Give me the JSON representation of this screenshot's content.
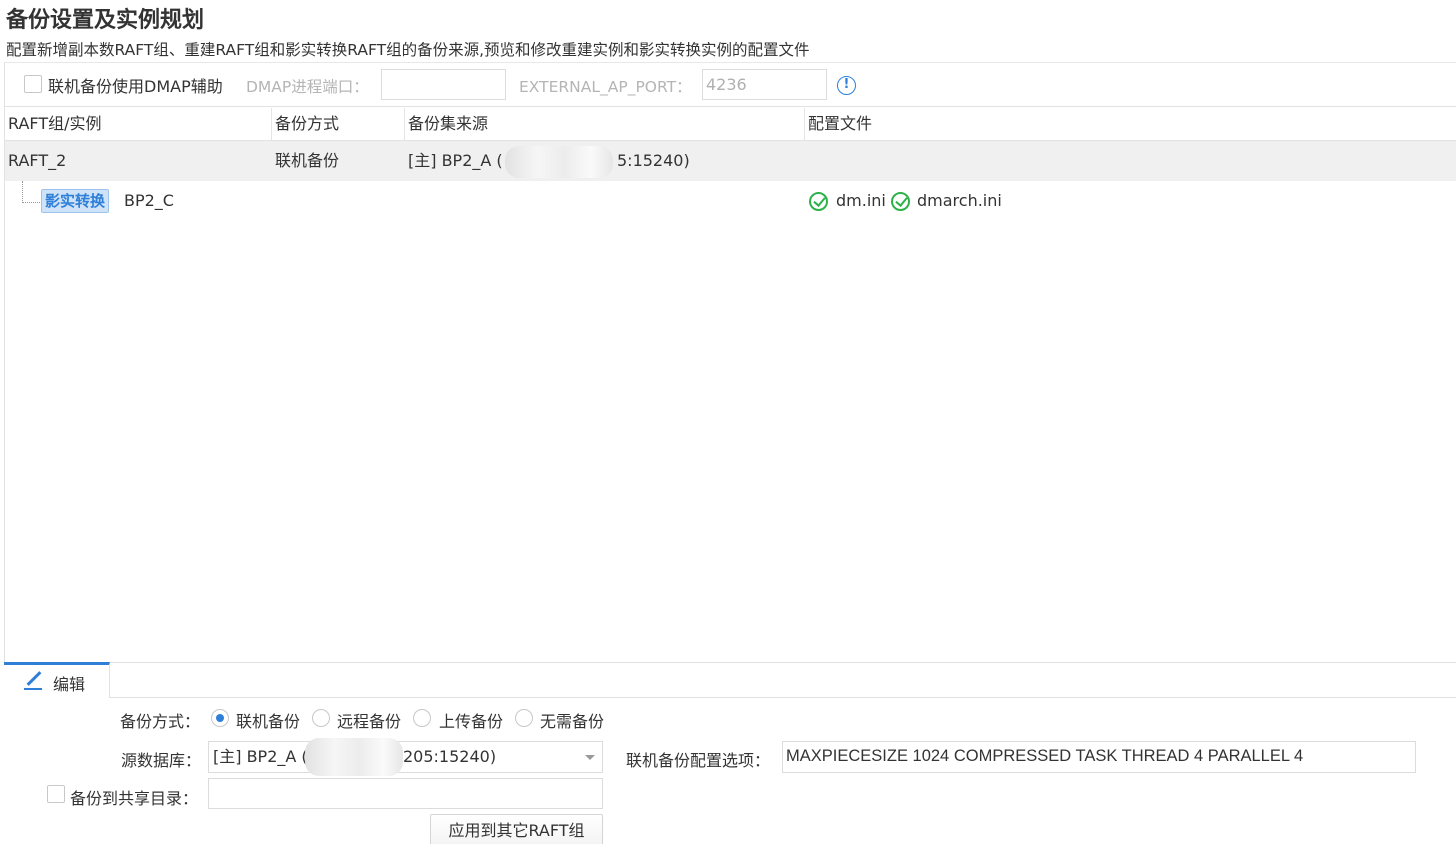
{
  "header": {
    "title": "备份设置及实例规划",
    "description": "配置新增副本数RAFT组、重建RAFT组和影实转换RAFT组的备份来源,预览和修改重建实例和影实转换实例的配置文件"
  },
  "dmap": {
    "checkbox_label": "联机备份使用DMAP辅助",
    "checked": false,
    "port_label": "DMAP进程端口：",
    "port_value": "",
    "ext_port_label": "EXTERNAL_AP_PORT：",
    "ext_port_value": "4236",
    "info_icon": "info-icon"
  },
  "table": {
    "columns": [
      "RAFT组/实例",
      "备份方式",
      "备份集来源",
      "配置文件"
    ],
    "raft_row": {
      "name": "RAFT_2",
      "method": "联机备份",
      "source_prefix": "[主] BP2_A (",
      "source_suffix": "5:15240)"
    },
    "instance_row": {
      "tag": "影实转换",
      "name": "BP2_C",
      "config_files": [
        "dm.ini",
        "dmarch.ini"
      ],
      "status_icon": "check-circle-icon",
      "status_color": "#2db24a"
    }
  },
  "editor": {
    "tab_label": "编辑",
    "tab_icon": "pencil-icon",
    "method_label": "备份方式：",
    "methods": [
      {
        "label": "联机备份",
        "checked": true
      },
      {
        "label": "远程备份",
        "checked": false
      },
      {
        "label": "上传备份",
        "checked": false
      },
      {
        "label": "无需备份",
        "checked": false
      }
    ],
    "source_db_label": "源数据库：",
    "source_db_prefix": "[主] BP2_A (",
    "source_db_suffix": "205:15240)",
    "options_label": "联机备份配置选项：",
    "options_value": "MAXPIECESIZE 1024 COMPRESSED TASK THREAD 4 PARALLEL 4",
    "share_checkbox_label": "备份到共享目录：",
    "share_checked": false,
    "share_value": "",
    "apply_button": "应用到其它RAFT组"
  },
  "colors": {
    "accent": "#2f7fd8",
    "success": "#2db24a",
    "muted_text": "#b5b5b5",
    "row_highlight": "#f0f0f0"
  }
}
